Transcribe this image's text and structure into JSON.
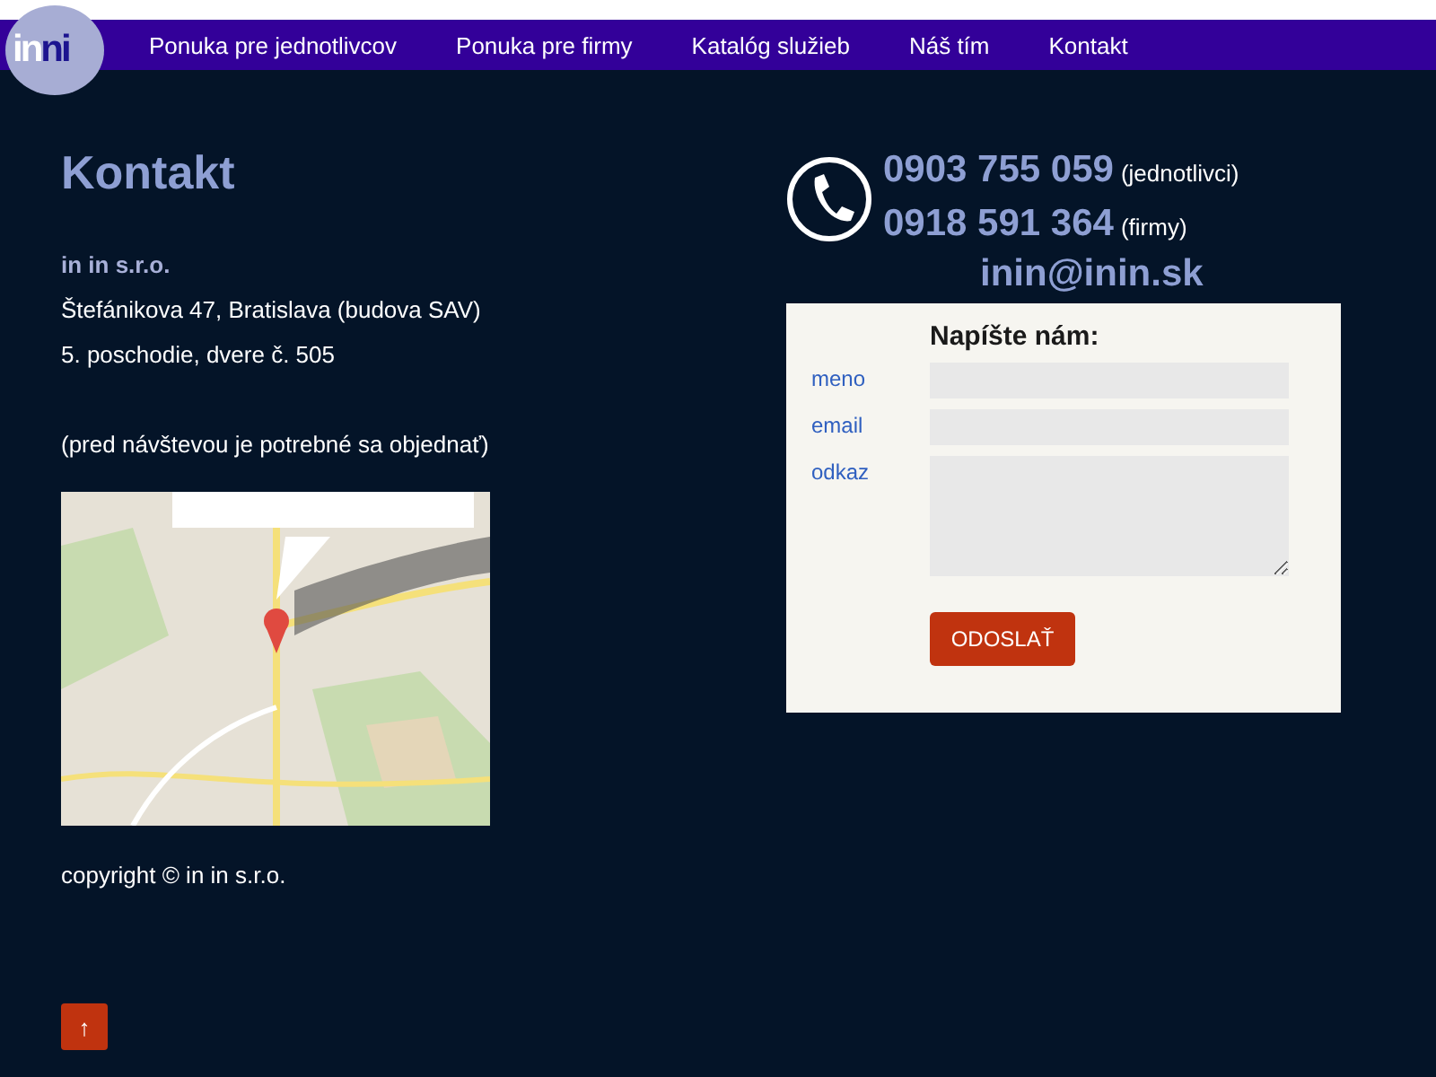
{
  "logo": [
    {
      "text": "in",
      "color": "#ffffff"
    },
    {
      "text": "ni",
      "color": "#1c1490"
    }
  ],
  "nav": [
    "Ponuka pre jednotlivcov",
    "Ponuka pre firmy",
    "Katalóg služieb",
    "Náš tím",
    "Kontakt"
  ],
  "heading": "Kontakt",
  "company": "in in s.r.o.",
  "address": [
    "Štefánikova 47, Bratislava (budova SAV)",
    "5. poschodie, dvere č. 505"
  ],
  "note": "(pred návštevou je potrebné sa objednať)",
  "map": {
    "kind": "picture"
  },
  "copyright": "copyright © in in s.r.o.",
  "phones": [
    {
      "number": "0903 755 059",
      "label": "(jednotlivci)"
    },
    {
      "number": "0918 591 364",
      "label": "(firmy)"
    }
  ],
  "email": "inin@inin.sk",
  "form": {
    "title": "Napíšte nám:",
    "fields": [
      {
        "label": "meno",
        "kind": "input"
      },
      {
        "label": "email",
        "kind": "input"
      },
      {
        "label": "odkaz",
        "kind": "textarea"
      }
    ],
    "submit": "ODOSLAŤ"
  },
  "top_button": "↑"
}
